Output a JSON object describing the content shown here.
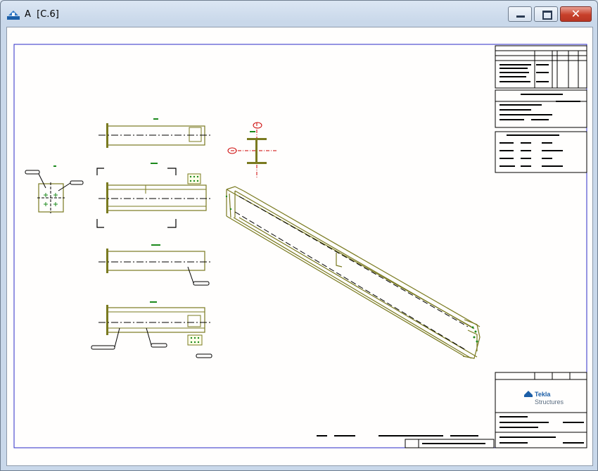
{
  "window": {
    "title": "A  [C.6]",
    "controls": {
      "minimize": "minimize",
      "maximize": "maximize",
      "close": "close"
    }
  },
  "drawing": {
    "logo_brand": "Tekla",
    "logo_product": "Structures",
    "colors": {
      "frame": "#2b2bc8",
      "part": "#7a7a20",
      "bolt": "#1d8a1d",
      "mark": "#cc0000",
      "line": "#000000"
    }
  }
}
